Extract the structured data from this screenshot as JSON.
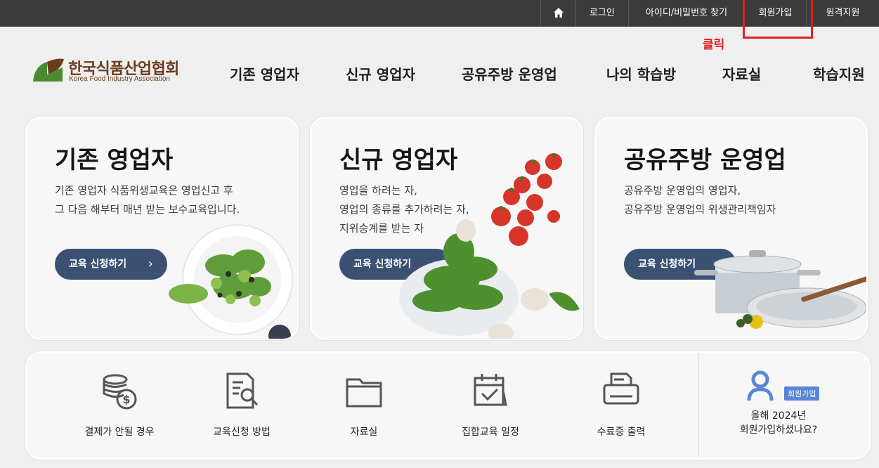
{
  "topbar": {
    "home_icon": "home-icon",
    "login": "로그인",
    "find_id_pw": "아이디/비밀번호 찾기",
    "join": "회원가입",
    "remote_support": "원격지원"
  },
  "annotation": {
    "click_label": "클릭",
    "color": "#e02020"
  },
  "logo": {
    "korean": "한국식품산업협회",
    "english": "Korea Food Industry Association"
  },
  "nav": [
    "기존 영업자",
    "신규 영업자",
    "공유주방 운영업",
    "나의 학습방",
    "자료실",
    "학습지원"
  ],
  "cards": [
    {
      "title": "기존 영업자",
      "desc": "기존 영업자 식품위생교육은 영업신고 후\n그 다음 해부터 매년 받는 보수교육입니다.",
      "button": "교육 신청하기",
      "image": "salad-bowl-image"
    },
    {
      "title": "신규 영업자",
      "desc": "영업을 하려는 자,\n영업의 종류를 추가하려는 자,\n지위승계를 받는 자",
      "button": "교육 신청하기",
      "image": "tomato-spinach-image"
    },
    {
      "title": "공유주방 운영업",
      "desc": "공유주방 운영업의 영업자,\n공유주방 운영업의 위생관리책임자",
      "button": "교육 신청하기",
      "image": "cookware-image"
    }
  ],
  "quick_links": [
    {
      "label": "결제가 안될 경우",
      "icon": "coins-dollar-icon"
    },
    {
      "label": "교육신청 방법",
      "icon": "document-search-icon"
    },
    {
      "label": "자료실",
      "icon": "folder-icon"
    },
    {
      "label": "집합교육 일정",
      "icon": "calendar-check-icon"
    },
    {
      "label": "수료증 출력",
      "icon": "printer-icon"
    }
  ],
  "member": {
    "badge": "회원가입",
    "text": "올해 2024년\n회원가입하셨나요?",
    "icon": "user-icon"
  },
  "colors": {
    "accent_button": "#3b5172",
    "topbar": "#3b3b3b",
    "logo_brown": "#6b3c1e",
    "logo_green": "#4c8a2f",
    "member_blue": "#5b86d6"
  }
}
